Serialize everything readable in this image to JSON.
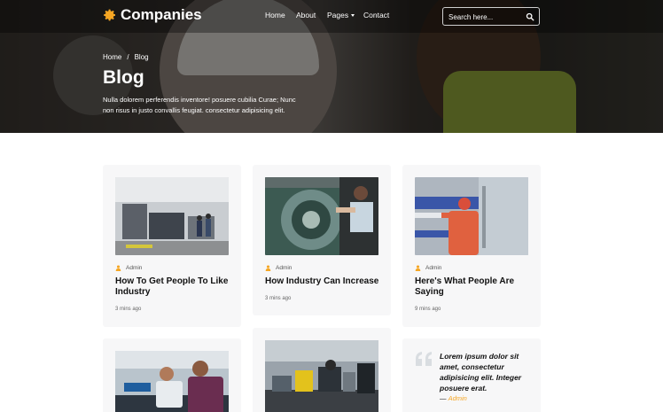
{
  "brand": {
    "name": "Companies",
    "icon": "gear-icon",
    "accent": "#f5a623"
  },
  "nav": {
    "items": [
      "Home",
      "About",
      "Pages",
      "Contact"
    ]
  },
  "search": {
    "placeholder": "Search here...",
    "icon": "search-icon"
  },
  "breadcrumb": {
    "home": "Home",
    "separator": "/",
    "current": "Blog"
  },
  "hero": {
    "title": "Blog",
    "description": "Nulla dolorem perferendis inventore! posuere cubilia Curae; Nunc non risus in justo convallis feugiat. consectetur adipisicing elit."
  },
  "posts": [
    {
      "author": "Admin",
      "title": "How To Get People To Like Industry",
      "time": "3 mins ago"
    },
    {
      "author": "Admin",
      "title": "How Industry Can Increase",
      "time": "3 mins ago"
    },
    {
      "author": "Admin",
      "title": "Here's What People Are Saying",
      "time": "9 mins ago"
    }
  ],
  "quote": {
    "text": "Lorem ipsum dolor sit amet, consectetur adipisicing elit. Integer posuere erat.",
    "dash": "—",
    "author": "Admin"
  }
}
